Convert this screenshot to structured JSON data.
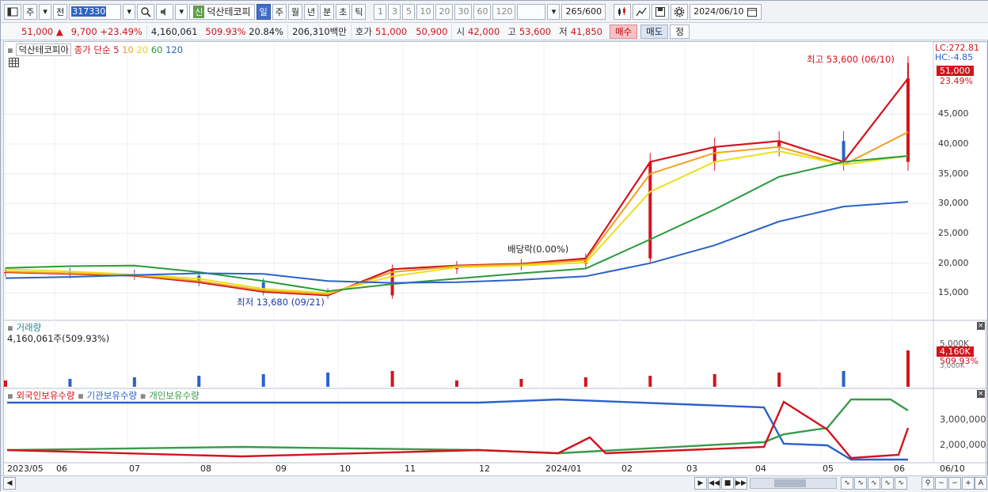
{
  "toolbar": {
    "period_label": "주",
    "prev_label": "전",
    "stock_code": "317330",
    "badge": "신",
    "stock_name": "덕산테코피",
    "periods": [
      "일",
      "주",
      "월",
      "년",
      "분",
      "초",
      "틱"
    ],
    "active_period": "일",
    "intervals": [
      "1",
      "3",
      "5",
      "10",
      "20",
      "30",
      "60",
      "120"
    ],
    "count": "265",
    "count_max": "/600",
    "date": "2024/06/10"
  },
  "quote": {
    "price": "51,000",
    "change": "9,700",
    "change_pct": "+23.49%",
    "volume": "4,160,061",
    "volume_pct": "509.93%",
    "turnover_pct": "20.84%",
    "amount": "206,310백만",
    "bid_label": "호가",
    "ask": "51,000",
    "bid": "50,900",
    "open_label": "시",
    "open": "42,000",
    "high_label": "고",
    "high": "53,600",
    "low_label": "저",
    "low": "41,850",
    "buy_label": "매수",
    "sell_label": "매도",
    "extra_label": "정"
  },
  "price_pane": {
    "legend_name": "덕산테코피아",
    "legend_type": "종가 단순",
    "ma_periods": [
      "5",
      "10",
      "20",
      "60",
      "120"
    ],
    "ma_colors": [
      "#d2141c",
      "#f0a020",
      "#e8e020",
      "#2a9a3a",
      "#2a62c8"
    ],
    "lc_label": "LC:272.81",
    "hc_label": "HC:-4.85",
    "high_annot": "최고 53,600 (06/10)",
    "low_annot": "최저 13,680 (09/21)",
    "div_annot": "배당락(0.00%)",
    "last_price": "51,000",
    "last_pct": "23.49%",
    "y_ticks": [
      "45,000",
      "40,000",
      "35,000",
      "30,000",
      "25,000",
      "20,000",
      "15,000"
    ]
  },
  "volume_pane": {
    "title": "거래량",
    "value": "4,160,061주(509.93%)",
    "y_tick": "5,000K",
    "last_value": "4,160K",
    "last_pct": "509.93%",
    "third": "3,000K"
  },
  "holding_pane": {
    "series_labels": [
      "외국인보유수량",
      "기관보유수량",
      "개인보유수량"
    ],
    "series_colors": [
      "#d2141c",
      "#2a62c8",
      "#3a9a4a"
    ],
    "y_ticks": [
      "3,000,000",
      "2,000,000"
    ]
  },
  "x_axis": {
    "labels": [
      "2023/05",
      "06",
      "07",
      "08",
      "09",
      "10",
      "11",
      "12",
      "2024/01",
      "02",
      "03",
      "04",
      "05",
      "06",
      "06/10"
    ]
  },
  "chart_data": {
    "type": "line",
    "x": [
      "2023/05",
      "2023/06",
      "2023/07",
      "2023/08",
      "2023/09",
      "2023/10",
      "2023/11",
      "2023/12",
      "2024/01",
      "2024/02",
      "2024/03",
      "2024/04",
      "2024/05",
      "2024/06",
      "2024/06/10"
    ],
    "series": [
      {
        "name": "5",
        "values": [
          18500,
          18200,
          17900,
          16800,
          15200,
          14600,
          19000,
          19600,
          19900,
          20800,
          37000,
          39500,
          40500,
          37000,
          51000
        ]
      },
      {
        "name": "10",
        "values": [
          18600,
          18300,
          18000,
          17000,
          15400,
          14800,
          18500,
          19500,
          19800,
          20500,
          35000,
          38500,
          39500,
          36500,
          42000
        ]
      },
      {
        "name": "20",
        "values": [
          19000,
          18600,
          18100,
          17400,
          15700,
          15000,
          17800,
          19300,
          19600,
          20100,
          32000,
          37000,
          38800,
          36500,
          38000
        ]
      },
      {
        "name": "60",
        "values": [
          19200,
          19500,
          19600,
          18500,
          17000,
          15300,
          16500,
          17400,
          18300,
          19100,
          24000,
          29000,
          34500,
          37000,
          38000
        ]
      },
      {
        "name": "120",
        "values": [
          17500,
          17700,
          18000,
          18300,
          18200,
          17000,
          16700,
          16800,
          17200,
          17800,
          20000,
          23000,
          27000,
          29500,
          30300
        ]
      }
    ],
    "ylim": [
      12000,
      55000
    ]
  }
}
